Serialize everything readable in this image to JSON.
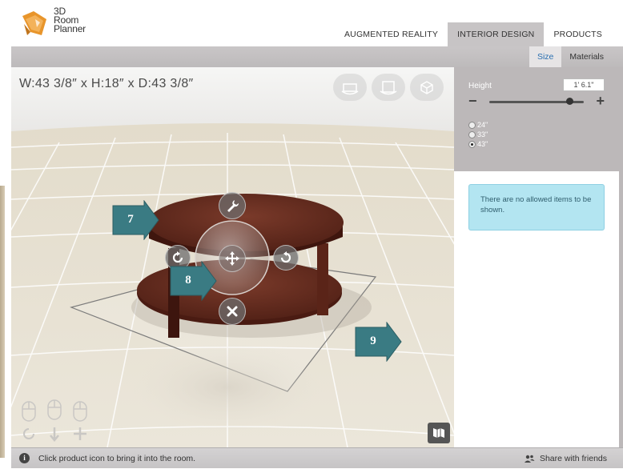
{
  "brand": {
    "line1": "3D",
    "line2": "Room",
    "line3": "Planner",
    "accent": "#e8952b"
  },
  "nav": [
    {
      "label": "AUGMENTED REALITY",
      "active": false
    },
    {
      "label": "INTERIOR DESIGN",
      "active": true
    },
    {
      "label": "PRODUCTS",
      "active": false
    }
  ],
  "subtabs": [
    {
      "label": "Size",
      "active": true
    },
    {
      "label": "Materials",
      "active": false
    }
  ],
  "viewport": {
    "dimensions": "W:43 3/8″ x H:18″ x D:43 3/8″",
    "view_buttons": [
      "view-front-icon",
      "view-top-icon",
      "view-3d-icon"
    ],
    "controls": [
      "wrench-icon",
      "move-icon",
      "rotate-left-icon",
      "rotate-right-icon",
      "close-icon"
    ],
    "callouts": [
      "7",
      "8",
      "9"
    ]
  },
  "panel": {
    "height_label": "Height",
    "height_value": "1' 6.1\"",
    "slider_fraction": 0.85,
    "options": [
      {
        "label": "24\"",
        "checked": false
      },
      {
        "label": "33\"",
        "checked": false
      },
      {
        "label": "43\"",
        "checked": true
      }
    ],
    "notice": "There are no allowed items to be shown."
  },
  "status": {
    "hint": "Click product icon to bring it into the room.",
    "share": "Share with friends"
  }
}
